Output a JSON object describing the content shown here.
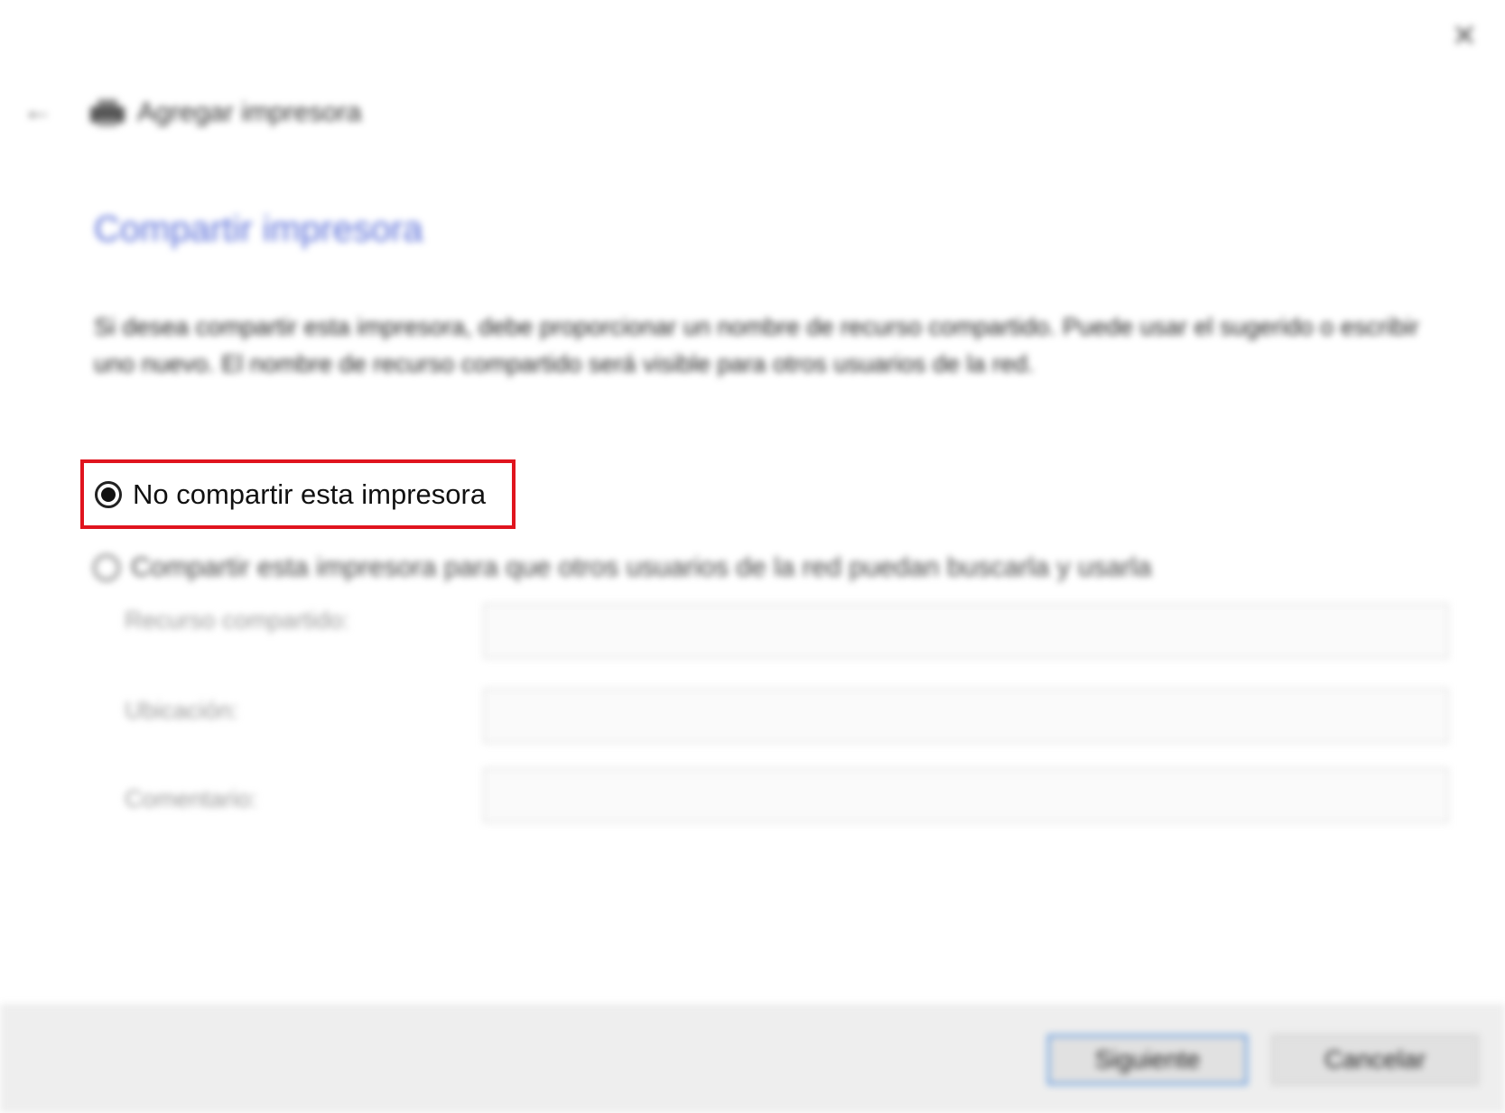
{
  "window": {
    "close_glyph": "✕",
    "back_glyph": "←",
    "header_title": "Agregar impresora"
  },
  "page": {
    "section_title": "Compartir impresora",
    "description": "Si desea compartir esta impresora, debe proporcionar un nombre de recurso compartido. Puede usar el sugerido o escribir uno nuevo. El nombre de recurso compartido será visible para otros usuarios de la red."
  },
  "options": {
    "no_share_label": "No compartir esta impresora",
    "share_label": "Compartir esta impresora para que otros usuarios de la red puedan buscarla y usarla",
    "selected": "no_share"
  },
  "fields": {
    "share_name_label": "Recurso compartido:",
    "share_name_value": "",
    "location_label": "Ubicación:",
    "location_value": "",
    "comment_label": "Comentario:",
    "comment_value": ""
  },
  "footer": {
    "next_label": "Siguiente",
    "cancel_label": "Cancelar"
  },
  "colors": {
    "highlight": "#e0141e",
    "section_title": "#5b6fd8",
    "default_button_border": "#6a9fe0"
  }
}
